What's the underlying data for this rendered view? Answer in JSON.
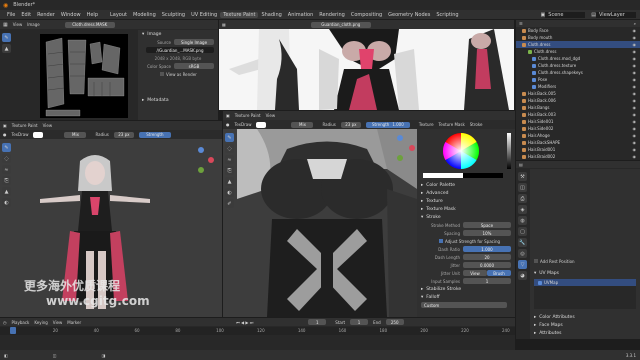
{
  "window": {
    "title": "Blender*",
    "menu": [
      "File",
      "Edit",
      "Render",
      "Window",
      "Help"
    ],
    "workspaces": [
      "Layout",
      "Modeling",
      "Sculpting",
      "UV Editing",
      "Texture Paint",
      "Shading",
      "Animation",
      "Rendering",
      "Compositing",
      "Geometry Nodes",
      "Scripting"
    ],
    "scene": "Scene",
    "view_layer": "ViewLayer"
  },
  "image_editor": {
    "menus": [
      "View",
      "Image"
    ],
    "image_name": "Cloth.dress.MASK",
    "props": {
      "section": "Image",
      "source_label": "Source",
      "source_value": "Single Image",
      "file": "//Guardian_...MASK.png",
      "info": "2048 x 2048, RGB byte",
      "color_space_label": "Color Space",
      "color_space_value": "sRGB",
      "view_as_render": "View as Render",
      "metadata": "Metadata"
    }
  },
  "uv_view": {
    "image_name": "Guardian_cloth.png"
  },
  "viewport_left": {
    "mode": "Texture Paint",
    "menus": [
      "View"
    ],
    "brush": "TexDraw",
    "blend": "Mix",
    "radius_label": "Radius",
    "radius_value": "23 px",
    "strength_label": "Strength"
  },
  "viewport_main": {
    "mode": "Texture Paint",
    "menus": [
      "View"
    ],
    "brush": "TexDraw",
    "blend": "Mix",
    "radius_label": "Radius",
    "radius_value": "23 px",
    "strength_label": "Strength",
    "strength_value": "1.000",
    "right_menus": [
      "Texture",
      "Texture Mask",
      "Stroke"
    ],
    "n_panel": {
      "sections": [
        "Color Palette",
        "Advanced",
        "Texture",
        "Texture Mask",
        "Stroke"
      ],
      "stroke_method_label": "Stroke Method",
      "stroke_method_value": "Space",
      "spacing_label": "Spacing",
      "spacing_value": "10%",
      "adjust_label": "Adjust Strength for Spacing",
      "dash_ratio_label": "Dash Ratio",
      "dash_ratio_value": "1.000",
      "dash_length_label": "Dash Length",
      "dash_length_value": "20",
      "jitter_label": "Jitter",
      "jitter_value": "0.0000",
      "jitter_unit_label": "Jitter Unit",
      "jitter_unit_view": "View",
      "jitter_unit_brush": "Brush",
      "input_samples_label": "Input Samples",
      "input_samples_value": "1",
      "stabilize": "Stabilize Stroke",
      "falloff": "Falloff",
      "falloff_value": "Custom"
    }
  },
  "outliner": {
    "items": [
      {
        "name": "Body Face",
        "kind": "obj"
      },
      {
        "name": "Body mouth",
        "kind": "obj"
      },
      {
        "name": "Cloth.dress",
        "kind": "obj",
        "selected": true
      },
      {
        "name": "Cloth.dress",
        "kind": "mesh"
      },
      {
        "name": "Cloth.dress.mod_dgd",
        "kind": "mod"
      },
      {
        "name": "Cloth.dress.texture",
        "kind": "mod"
      },
      {
        "name": "Cloth.dress.shapekeys",
        "kind": "mod"
      },
      {
        "name": "Pose",
        "kind": "mod"
      },
      {
        "name": "Modifiers",
        "kind": "mod"
      },
      {
        "name": "Hair.Back.005",
        "kind": "obj"
      },
      {
        "name": "Hair.Back.006",
        "kind": "obj"
      },
      {
        "name": "Hair.Bangs",
        "kind": "obj"
      },
      {
        "name": "Hair.Back.003",
        "kind": "obj"
      },
      {
        "name": "Hair.Side001",
        "kind": "obj"
      },
      {
        "name": "Hair.Side002",
        "kind": "obj"
      },
      {
        "name": "Hair.Ahoge",
        "kind": "obj"
      },
      {
        "name": "Hair.BackSHAPE",
        "kind": "obj"
      },
      {
        "name": "Hair.Braid001",
        "kind": "obj"
      },
      {
        "name": "Hair.Braid002",
        "kind": "obj"
      },
      {
        "name": "Hair.Back",
        "kind": "obj"
      },
      {
        "name": "Hair.Ear",
        "kind": "obj"
      },
      {
        "name": "Hair.front",
        "kind": "obj"
      },
      {
        "name": "Hair.Front.002",
        "kind": "obj"
      },
      {
        "name": "Hair.Ear",
        "kind": "obj"
      },
      {
        "name": "Hair.ID",
        "kind": "obj"
      }
    ]
  },
  "properties": {
    "add_rest_position": "Add Rest Position",
    "uv_maps_section": "UV Maps",
    "uv_map": "UVMap",
    "color_attributes": "Color Attributes",
    "face_maps": "Face Maps",
    "attributes": "Attributes"
  },
  "timeline": {
    "menus": [
      "Playback",
      "Keying",
      "View",
      "Marker"
    ],
    "current_frame": "1",
    "start_label": "Start",
    "start_value": "1",
    "end_label": "End",
    "end_value": "250",
    "ticks": [
      "0",
      "20",
      "40",
      "60",
      "80",
      "100",
      "120",
      "140",
      "160",
      "180",
      "200",
      "220",
      "240"
    ]
  },
  "status": {
    "version": "3.3.1"
  },
  "watermark": {
    "line1": "更多海外优质课程",
    "line2": "www.cgitg.com"
  },
  "colors": {
    "accent": "#4772b3",
    "header": "#303030",
    "panel": "#282828",
    "viewport": "#3d3d3d",
    "outline_orange": "#c88b4f"
  }
}
